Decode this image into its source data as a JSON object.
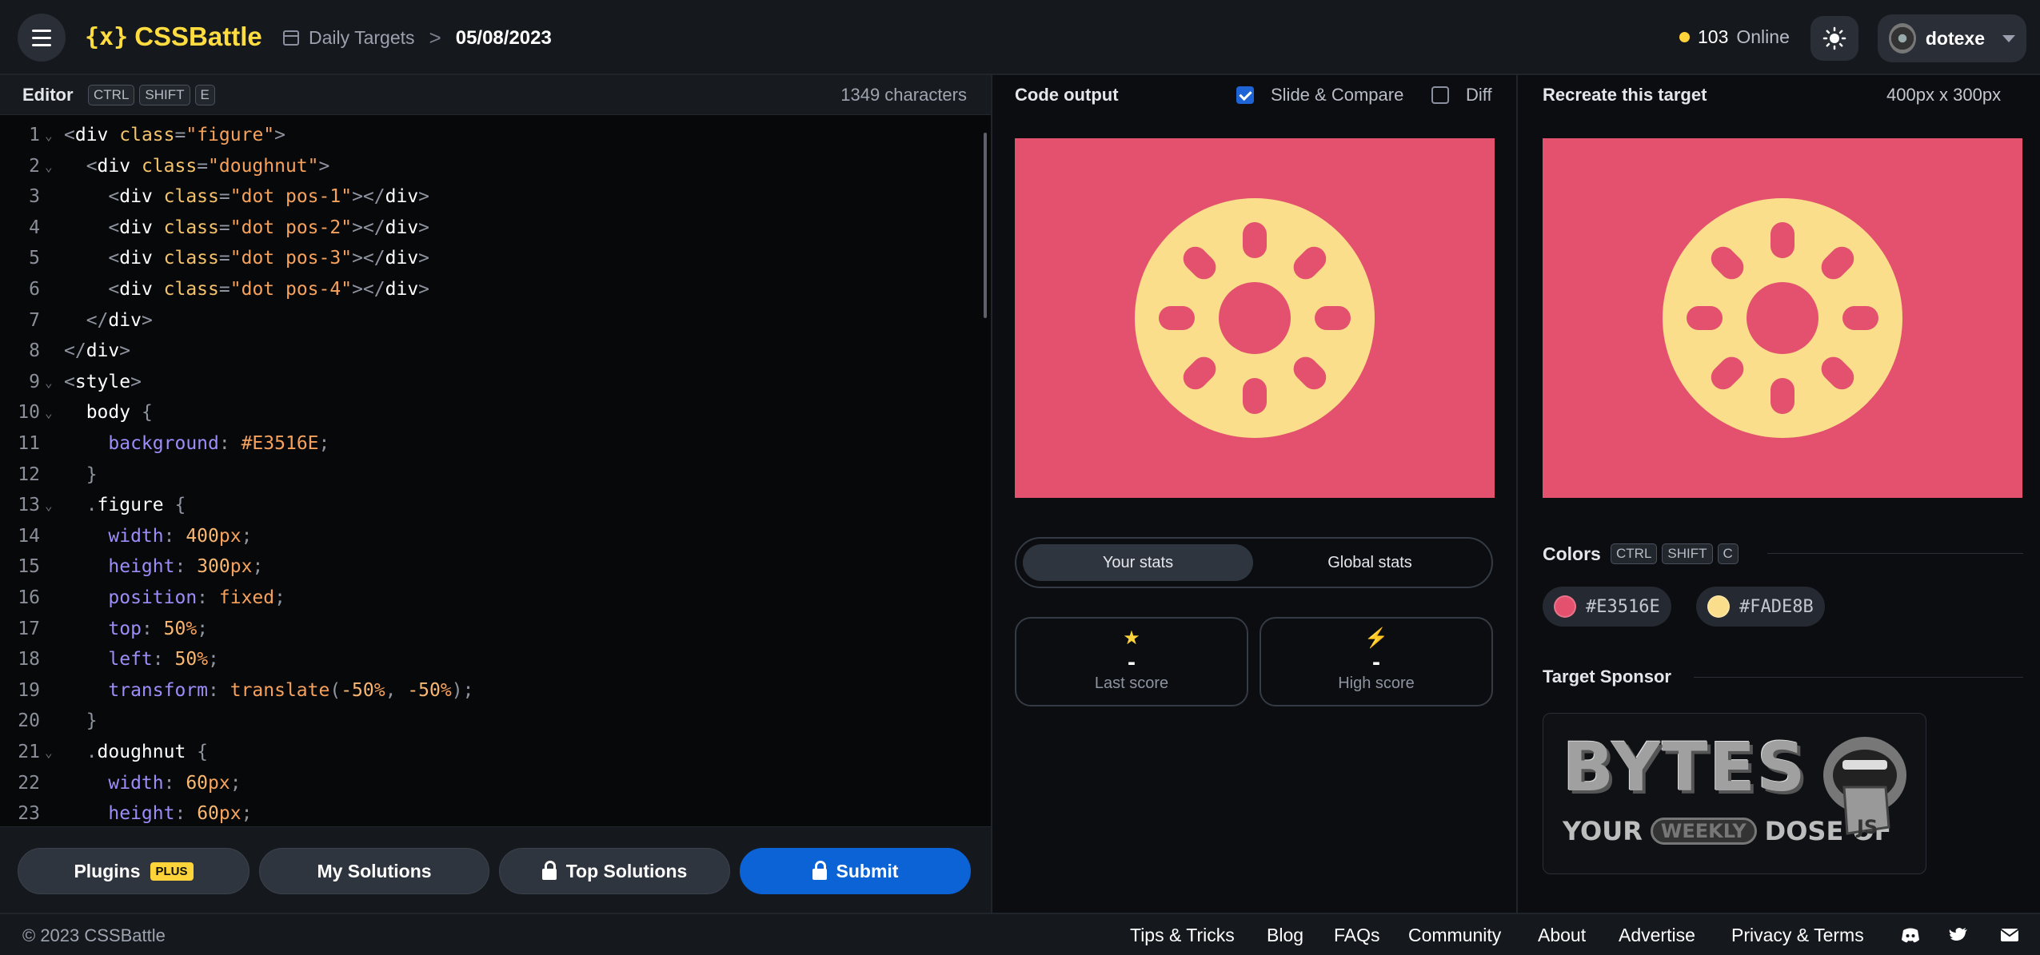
{
  "header": {
    "logo_mark": "{x}",
    "logo_text": "CSSBattle",
    "breadcrumb_link": "Daily Targets",
    "breadcrumb_sep": ">",
    "breadcrumb_current": "05/08/2023",
    "online_count": "103",
    "online_label": "Online",
    "username": "dotexe"
  },
  "editor": {
    "title": "Editor",
    "shortcut": [
      "CTRL",
      "SHIFT",
      "E"
    ],
    "char_count": "1349 characters",
    "lines": [
      {
        "n": "1",
        "fold": true,
        "tokens": [
          [
            "p",
            "<"
          ],
          [
            "tag",
            "div "
          ],
          [
            "attr",
            "class"
          ],
          [
            "p",
            "="
          ],
          [
            "str",
            "\"figure\""
          ],
          [
            "p",
            ">"
          ]
        ]
      },
      {
        "n": "2",
        "fold": true,
        "tokens": [
          [
            "p",
            "  <"
          ],
          [
            "tag",
            "div "
          ],
          [
            "attr",
            "class"
          ],
          [
            "p",
            "="
          ],
          [
            "str",
            "\"doughnut\""
          ],
          [
            "p",
            ">"
          ]
        ]
      },
      {
        "n": "3",
        "fold": false,
        "tokens": [
          [
            "p",
            "    <"
          ],
          [
            "tag",
            "div "
          ],
          [
            "attr",
            "class"
          ],
          [
            "p",
            "="
          ],
          [
            "str",
            "\"dot pos-1\""
          ],
          [
            "p",
            "></"
          ],
          [
            "tag",
            "div"
          ],
          [
            "p",
            ">"
          ]
        ]
      },
      {
        "n": "4",
        "fold": false,
        "tokens": [
          [
            "p",
            "    <"
          ],
          [
            "tag",
            "div "
          ],
          [
            "attr",
            "class"
          ],
          [
            "p",
            "="
          ],
          [
            "str",
            "\"dot pos-2\""
          ],
          [
            "p",
            "></"
          ],
          [
            "tag",
            "div"
          ],
          [
            "p",
            ">"
          ]
        ]
      },
      {
        "n": "5",
        "fold": false,
        "tokens": [
          [
            "p",
            "    <"
          ],
          [
            "tag",
            "div "
          ],
          [
            "attr",
            "class"
          ],
          [
            "p",
            "="
          ],
          [
            "str",
            "\"dot pos-3\""
          ],
          [
            "p",
            "></"
          ],
          [
            "tag",
            "div"
          ],
          [
            "p",
            ">"
          ]
        ]
      },
      {
        "n": "6",
        "fold": false,
        "tokens": [
          [
            "p",
            "    <"
          ],
          [
            "tag",
            "div "
          ],
          [
            "attr",
            "class"
          ],
          [
            "p",
            "="
          ],
          [
            "str",
            "\"dot pos-4\""
          ],
          [
            "p",
            "></"
          ],
          [
            "tag",
            "div"
          ],
          [
            "p",
            ">"
          ]
        ]
      },
      {
        "n": "7",
        "fold": false,
        "tokens": [
          [
            "p",
            "  </"
          ],
          [
            "tag",
            "div"
          ],
          [
            "p",
            ">"
          ]
        ]
      },
      {
        "n": "8",
        "fold": false,
        "tokens": [
          [
            "p",
            "</"
          ],
          [
            "tag",
            "div"
          ],
          [
            "p",
            ">"
          ]
        ]
      },
      {
        "n": "9",
        "fold": true,
        "tokens": [
          [
            "p",
            "<"
          ],
          [
            "tag",
            "style"
          ],
          [
            "p",
            ">"
          ]
        ]
      },
      {
        "n": "10",
        "fold": true,
        "tokens": [
          [
            "sel",
            "  body "
          ],
          [
            "p",
            "{"
          ]
        ]
      },
      {
        "n": "11",
        "fold": false,
        "tokens": [
          [
            "prop",
            "    background"
          ],
          [
            "p",
            ": "
          ],
          [
            "val",
            "#E3516E"
          ],
          [
            "p",
            ";"
          ]
        ]
      },
      {
        "n": "12",
        "fold": false,
        "tokens": [
          [
            "p",
            "  }"
          ]
        ]
      },
      {
        "n": "13",
        "fold": true,
        "tokens": [
          [
            "p",
            "  ."
          ],
          [
            "sel",
            "figure "
          ],
          [
            "p",
            "{"
          ]
        ]
      },
      {
        "n": "14",
        "fold": false,
        "tokens": [
          [
            "prop",
            "    width"
          ],
          [
            "p",
            ": "
          ],
          [
            "num",
            "400"
          ],
          [
            "val",
            "px"
          ],
          [
            "p",
            ";"
          ]
        ]
      },
      {
        "n": "15",
        "fold": false,
        "tokens": [
          [
            "prop",
            "    height"
          ],
          [
            "p",
            ": "
          ],
          [
            "num",
            "300"
          ],
          [
            "val",
            "px"
          ],
          [
            "p",
            ";"
          ]
        ]
      },
      {
        "n": "16",
        "fold": false,
        "tokens": [
          [
            "prop",
            "    position"
          ],
          [
            "p",
            ": "
          ],
          [
            "val",
            "fixed"
          ],
          [
            "p",
            ";"
          ]
        ]
      },
      {
        "n": "17",
        "fold": false,
        "tokens": [
          [
            "prop",
            "    top"
          ],
          [
            "p",
            ": "
          ],
          [
            "num",
            "50"
          ],
          [
            "val",
            "%"
          ],
          [
            "p",
            ";"
          ]
        ]
      },
      {
        "n": "18",
        "fold": false,
        "tokens": [
          [
            "prop",
            "    left"
          ],
          [
            "p",
            ": "
          ],
          [
            "num",
            "50"
          ],
          [
            "val",
            "%"
          ],
          [
            "p",
            ";"
          ]
        ]
      },
      {
        "n": "19",
        "fold": false,
        "tokens": [
          [
            "prop",
            "    transform"
          ],
          [
            "p",
            ": "
          ],
          [
            "val",
            "translate"
          ],
          [
            "p",
            "("
          ],
          [
            "num",
            "-50"
          ],
          [
            "val",
            "%"
          ],
          [
            "p",
            ", "
          ],
          [
            "num",
            "-50"
          ],
          [
            "val",
            "%"
          ],
          [
            "p",
            ");"
          ]
        ]
      },
      {
        "n": "20",
        "fold": false,
        "tokens": [
          [
            "p",
            "  }"
          ]
        ]
      },
      {
        "n": "21",
        "fold": true,
        "tokens": [
          [
            "p",
            "  ."
          ],
          [
            "sel",
            "doughnut "
          ],
          [
            "p",
            "{"
          ]
        ]
      },
      {
        "n": "22",
        "fold": false,
        "tokens": [
          [
            "prop",
            "    width"
          ],
          [
            "p",
            ": "
          ],
          [
            "num",
            "60"
          ],
          [
            "val",
            "px"
          ],
          [
            "p",
            ";"
          ]
        ]
      },
      {
        "n": "23",
        "fold": false,
        "tokens": [
          [
            "prop",
            "    height"
          ],
          [
            "p",
            ": "
          ],
          [
            "num",
            "60"
          ],
          [
            "val",
            "px"
          ],
          [
            "p",
            ";"
          ]
        ]
      }
    ],
    "buttons": {
      "plugins": "Plugins",
      "plugins_badge": "PLUS",
      "my_solutions": "My Solutions",
      "top_solutions": "Top Solutions",
      "submit": "Submit"
    }
  },
  "output": {
    "title": "Code output",
    "slide_compare": "Slide & Compare",
    "diff": "Diff",
    "tabs": [
      "Your stats",
      "Global stats"
    ],
    "last_score_value": "-",
    "last_score_label": "Last score",
    "high_score_value": "-",
    "high_score_label": "High score"
  },
  "target": {
    "title": "Recreate this target",
    "size": "400px x 300px",
    "colors_title": "Colors",
    "colors_shortcut": [
      "CTRL",
      "SHIFT",
      "C"
    ],
    "colors": [
      "#E3516E",
      "#FADE8B"
    ],
    "sponsor_title": "Target Sponsor",
    "sponsor_logo_text": "BYTES",
    "sponsor_tagline": [
      "YOUR",
      "WEEKLY",
      "DOSE OF"
    ],
    "sponsor_badge": "JS"
  },
  "footer": {
    "copyright": "© 2023 CSSBattle",
    "links": [
      "Tips & Tricks",
      "Blog",
      "FAQs",
      "Community",
      "About",
      "Advertise",
      "Privacy & Terms"
    ]
  },
  "colors": {
    "accent_yellow": "#ffd43b",
    "submit_blue": "#0b63d6",
    "target_bg": "#E3516E",
    "target_fg": "#FADE8B"
  }
}
